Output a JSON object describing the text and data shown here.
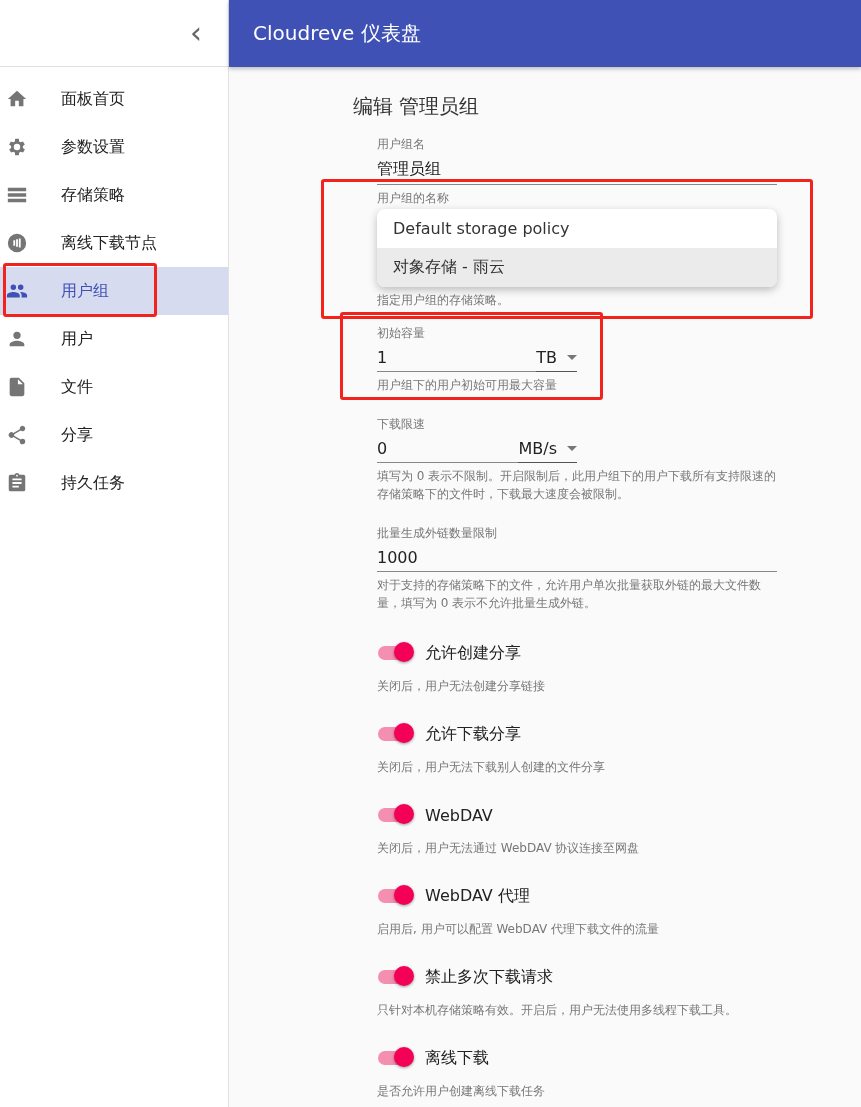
{
  "sidebar": {
    "collapse_icon": "‹",
    "items": [
      {
        "label": "面板首页",
        "selected": false,
        "highlighted": false
      },
      {
        "label": "参数设置",
        "selected": false,
        "highlighted": false
      },
      {
        "label": "存储策略",
        "selected": false,
        "highlighted": false
      },
      {
        "label": "离线下载节点",
        "selected": false,
        "highlighted": false
      },
      {
        "label": "用户组",
        "selected": true,
        "highlighted": true
      },
      {
        "label": "用户",
        "selected": false,
        "highlighted": false
      },
      {
        "label": "文件",
        "selected": false,
        "highlighted": false
      },
      {
        "label": "分享",
        "selected": false,
        "highlighted": false
      },
      {
        "label": "持久任务",
        "selected": false,
        "highlighted": false
      }
    ]
  },
  "app_bar": {
    "title": "Cloudreve 仪表盘"
  },
  "page_title": "编辑 管理员组",
  "fields": [
    {
      "kind": "text",
      "label": "用户组名",
      "value": "管理员组",
      "hint": "用户组的名称",
      "highlighted": false
    },
    {
      "kind": "menu",
      "hint": "指定用户组的存储策略。",
      "highlighted": true,
      "options": [
        {
          "label": "Default storage policy",
          "selected": false
        },
        {
          "label": "对象存储 - 雨云",
          "selected": true
        }
      ]
    },
    {
      "kind": "unit",
      "label": "初始容量",
      "value": "1",
      "unit": "TB",
      "hint": "用户组下的用户初始可用最大容量",
      "highlighted": true
    },
    {
      "kind": "unit",
      "label": "下载限速",
      "value": "0",
      "unit": "MB/s",
      "hint": "填写为 0 表示不限制。开启限制后，此用户组下的用户下载所有支持限速的存储策略下的文件时，下载最大速度会被限制。",
      "highlighted": false
    },
    {
      "kind": "text",
      "label": "批量生成外链数量限制",
      "value": "1000",
      "hint": "对于支持的存储策略下的文件，允许用户单次批量获取外链的最大文件数量，填写为 0 表示不允许批量生成外链。",
      "highlighted": false
    }
  ],
  "switches": [
    {
      "label": "允许创建分享",
      "on": true,
      "hint": "关闭后，用户无法创建分享链接"
    },
    {
      "label": "允许下载分享",
      "on": true,
      "hint": "关闭后，用户无法下载别人创建的文件分享"
    },
    {
      "label": "WebDAV",
      "on": true,
      "hint": "关闭后，用户无法通过 WebDAV 协议连接至网盘"
    },
    {
      "label": "WebDAV 代理",
      "on": true,
      "hint": "启用后, 用户可以配置 WebDAV 代理下载文件的流量"
    },
    {
      "label": "禁止多次下载请求",
      "on": true,
      "hint": "只针对本机存储策略有效。开启后，用户无法使用多线程下载工具。"
    },
    {
      "label": "离线下载",
      "on": true,
      "hint": "是否允许用户创建离线下载任务"
    }
  ]
}
